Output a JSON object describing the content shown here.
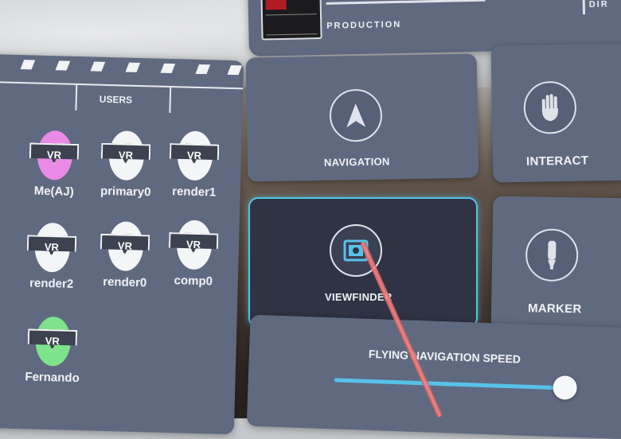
{
  "production_panel": {
    "label": "PRODUCTION",
    "right_label": "DIR"
  },
  "users_panel": {
    "title": "USERS",
    "users": [
      {
        "name": "Me(AJ)",
        "badge": "VR",
        "color": "#e98ae6"
      },
      {
        "name": "primary0",
        "badge": "VR",
        "color": "#f4f5f7"
      },
      {
        "name": "render1",
        "badge": "VR",
        "color": "#f4f5f7"
      },
      {
        "name": "render2",
        "badge": "VR",
        "color": "#f4f5f7"
      },
      {
        "name": "render0",
        "badge": "VR",
        "color": "#f4f5f7"
      },
      {
        "name": "comp0",
        "badge": "VR",
        "color": "#f4f5f7"
      },
      {
        "name": "Fernando",
        "badge": "VR",
        "color": "#7fe38d"
      }
    ]
  },
  "tools": {
    "navigation": {
      "label": "NAVIGATION",
      "icon": "navigation-arrow-icon"
    },
    "interact": {
      "label": "INTERACT",
      "icon": "hand-icon"
    },
    "viewfinder": {
      "label": "VIEWFINDER",
      "icon": "camera-viewfinder-icon",
      "selected": true
    },
    "marker": {
      "label": "MARKER",
      "icon": "marker-pen-icon"
    }
  },
  "speed_slider": {
    "label": "FLYING NAVIGATION SPEED",
    "value_fraction": 0.98,
    "accent": "#56c2ea"
  },
  "colors": {
    "panel": "#5f6a80",
    "selected_tile": "#2f3445",
    "highlight": "#56c2ea"
  }
}
